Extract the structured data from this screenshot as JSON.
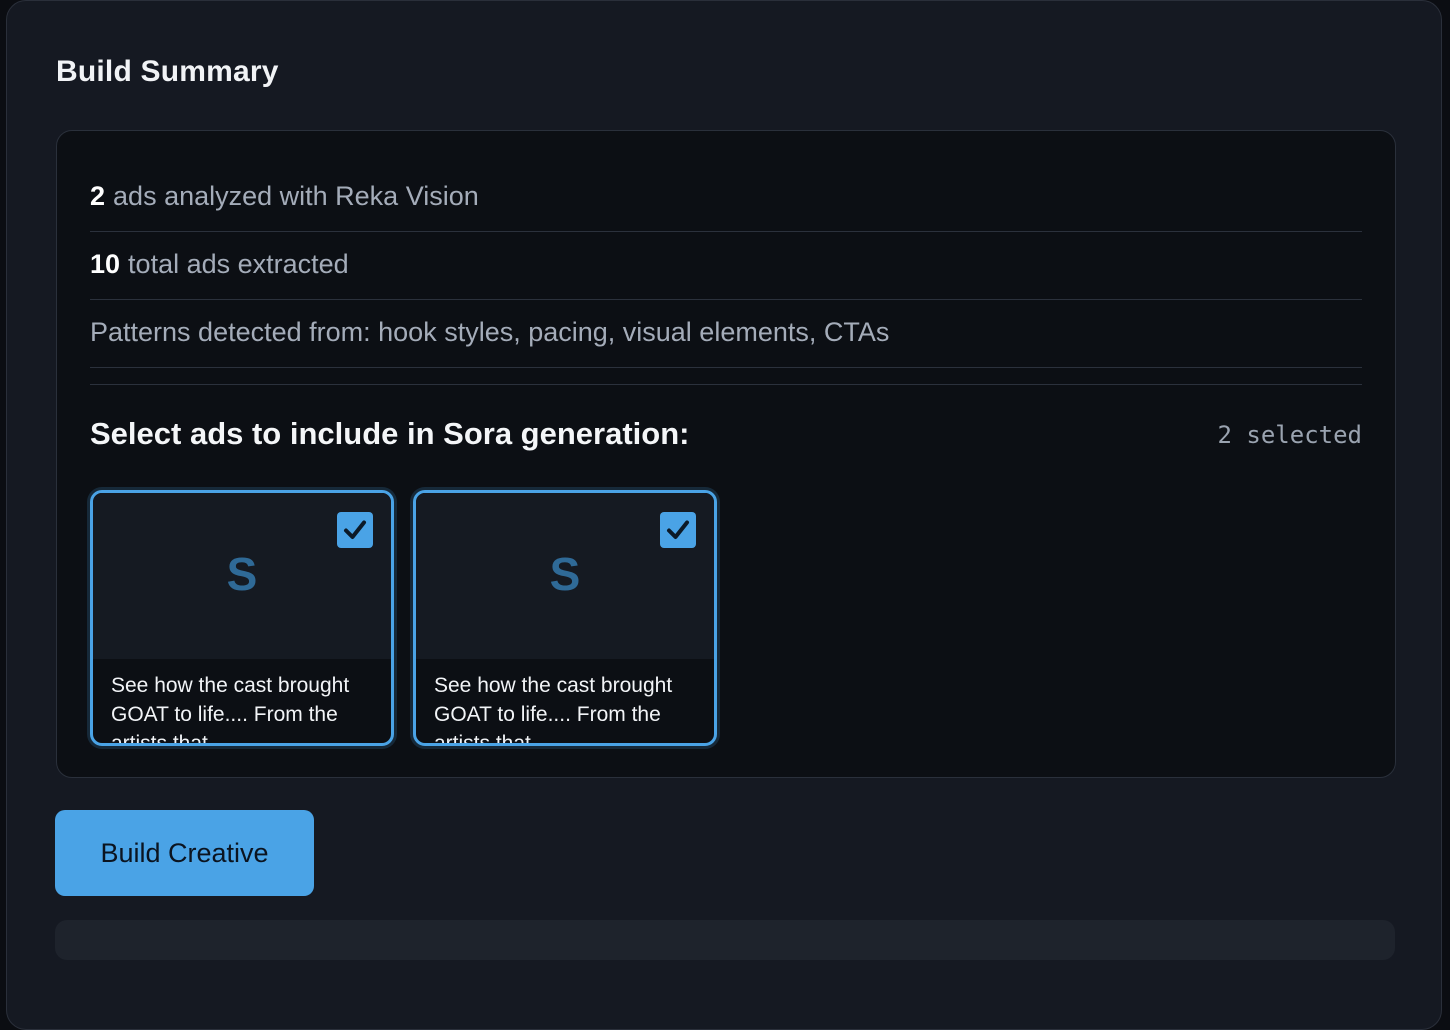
{
  "summary": {
    "title": "Build Summary",
    "stats": [
      {
        "value": "2",
        "text": "ads analyzed with Reka Vision"
      },
      {
        "value": "10",
        "text": "total ads extracted"
      }
    ],
    "patterns_text": "Patterns detected from: hook styles, pacing, visual elements, CTAs"
  },
  "selection": {
    "heading": "Select ads to include in Sora generation:",
    "count_label": "2 selected",
    "cards": [
      {
        "letter": "S",
        "checked": true,
        "caption": "See how the cast brought GOAT to life.... From the artists that"
      },
      {
        "letter": "S",
        "checked": true,
        "caption": "See how the cast brought GOAT to life.... From the artists that"
      }
    ]
  },
  "actions": {
    "build_label": "Build Creative"
  },
  "progress": {
    "value_percent": 0
  },
  "colors": {
    "accent": "#4aa3e6",
    "panel_bg": "#151922",
    "box_bg": "#0c0f14"
  }
}
